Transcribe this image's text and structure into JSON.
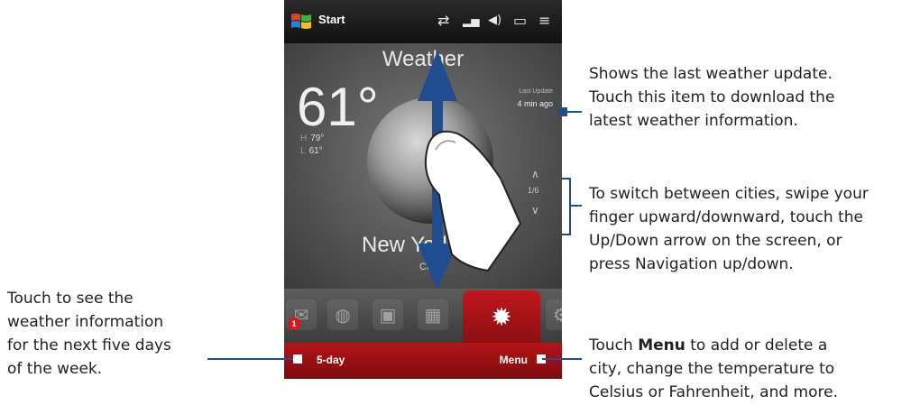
{
  "status_bar": {
    "start_label": "Start",
    "icons": [
      "data-sync-icon",
      "signal-icon",
      "volume-icon",
      "battery-icon",
      "menu-icon"
    ],
    "icon_glyphs": [
      "⇄",
      "▂▅",
      "◀)",
      "▭",
      "≡"
    ]
  },
  "weather": {
    "title": "Weather",
    "temperature": "61°",
    "high_label": "H",
    "high_value": "79°",
    "low_label": "L",
    "low_value": "61°",
    "last_update_label": "Last Update",
    "last_update_value": "4 min ago",
    "city_page": "1/6",
    "city_name": "New York, NY",
    "condition": "Clear"
  },
  "tabs": {
    "badge_count": "1",
    "icons": [
      "mail-icon",
      "globe-icon",
      "photo-icon",
      "music-icon",
      "weather-sun-icon",
      "settings-icon"
    ],
    "glyphs": [
      "✉",
      "◍",
      "▣",
      "▦",
      "✹",
      "⚙"
    ]
  },
  "softkeys": {
    "left": "5-day",
    "right": "Menu"
  },
  "callouts": {
    "last_update": [
      "Shows the last weather update.",
      "Touch this item to download the",
      "latest weather information."
    ],
    "switch_cities": [
      "To switch between cities, swipe your",
      "finger upward/downward, touch the",
      "Up/Down arrow on the screen, or",
      "press Navigation up/down."
    ],
    "five_day": [
      "Touch to see the",
      "weather information",
      "for the next five days",
      "of the week."
    ],
    "menu_prefix": "Touch ",
    "menu_bold": "Menu",
    "menu_line1_suffix": " to add or delete a",
    "menu_lines": [
      "city, change the temperature to",
      "Celsius or Fahrenheit, and more."
    ]
  },
  "colors": {
    "accent_blue": "#1f4d8f",
    "softkey_red": "#b41418"
  }
}
